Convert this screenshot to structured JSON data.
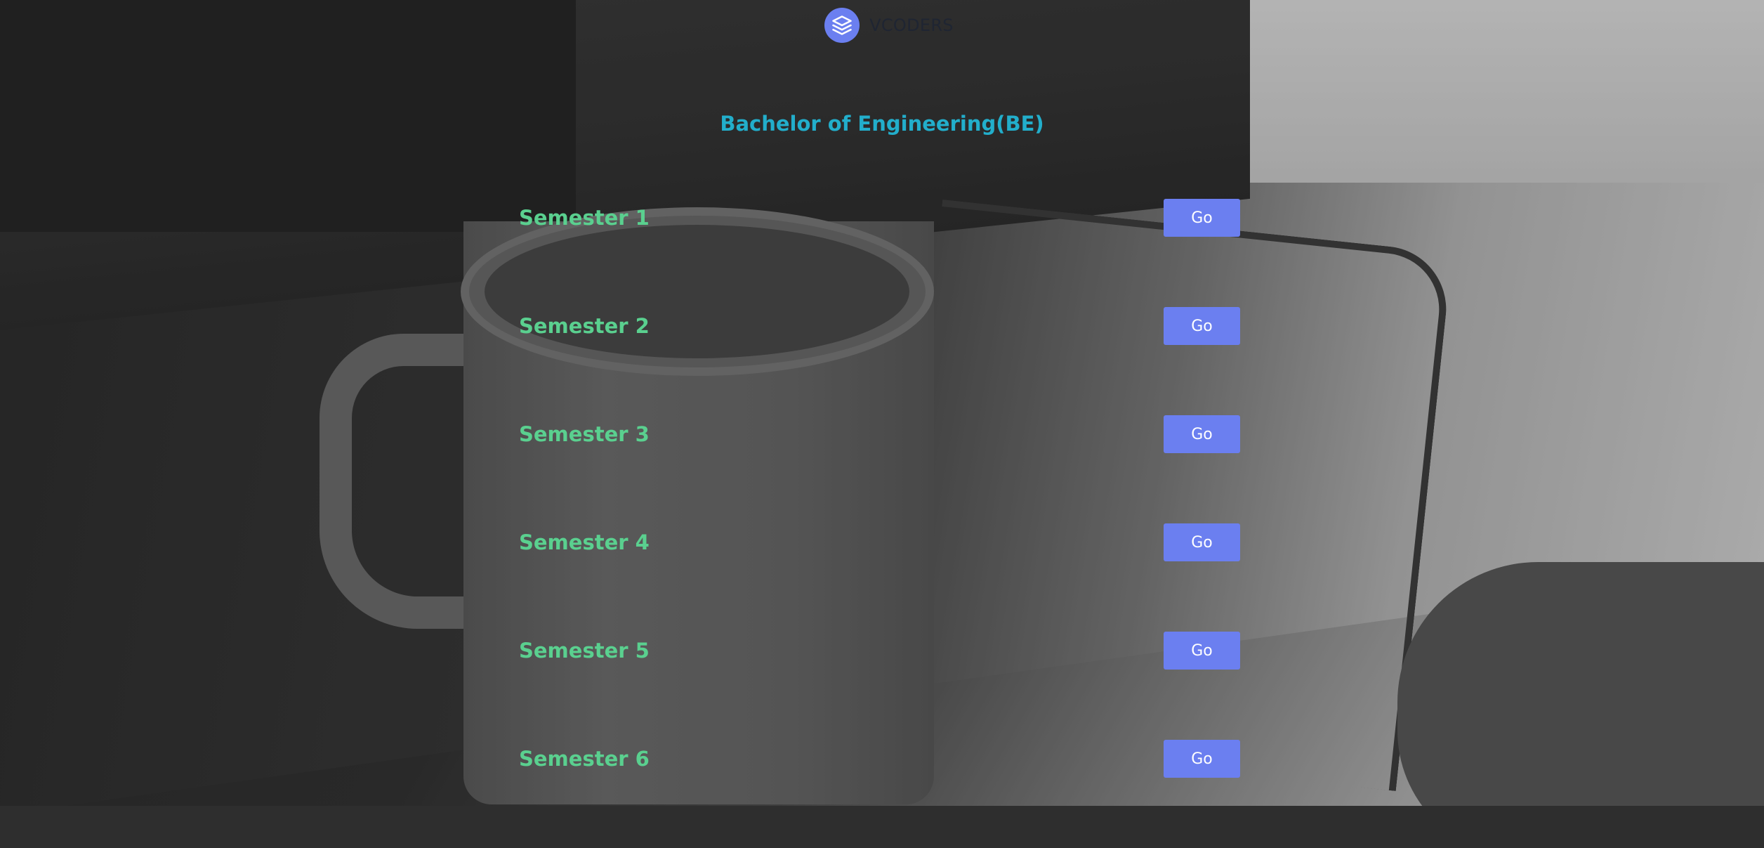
{
  "header": {
    "logo_icon": "layers-icon",
    "brand_name": "VCODERS",
    "accent_color": "#6b7ff0"
  },
  "main": {
    "title": "Bachelor of Engineering(BE)",
    "title_color": "#22aecb",
    "label_color": "#5ad08f",
    "semesters": [
      {
        "label": "Semester 1",
        "button_label": "Go"
      },
      {
        "label": "Semester 2",
        "button_label": "Go"
      },
      {
        "label": "Semester 3",
        "button_label": "Go"
      },
      {
        "label": "Semester 4",
        "button_label": "Go"
      },
      {
        "label": "Semester 5",
        "button_label": "Go"
      },
      {
        "label": "Semester 6",
        "button_label": "Go"
      }
    ]
  }
}
